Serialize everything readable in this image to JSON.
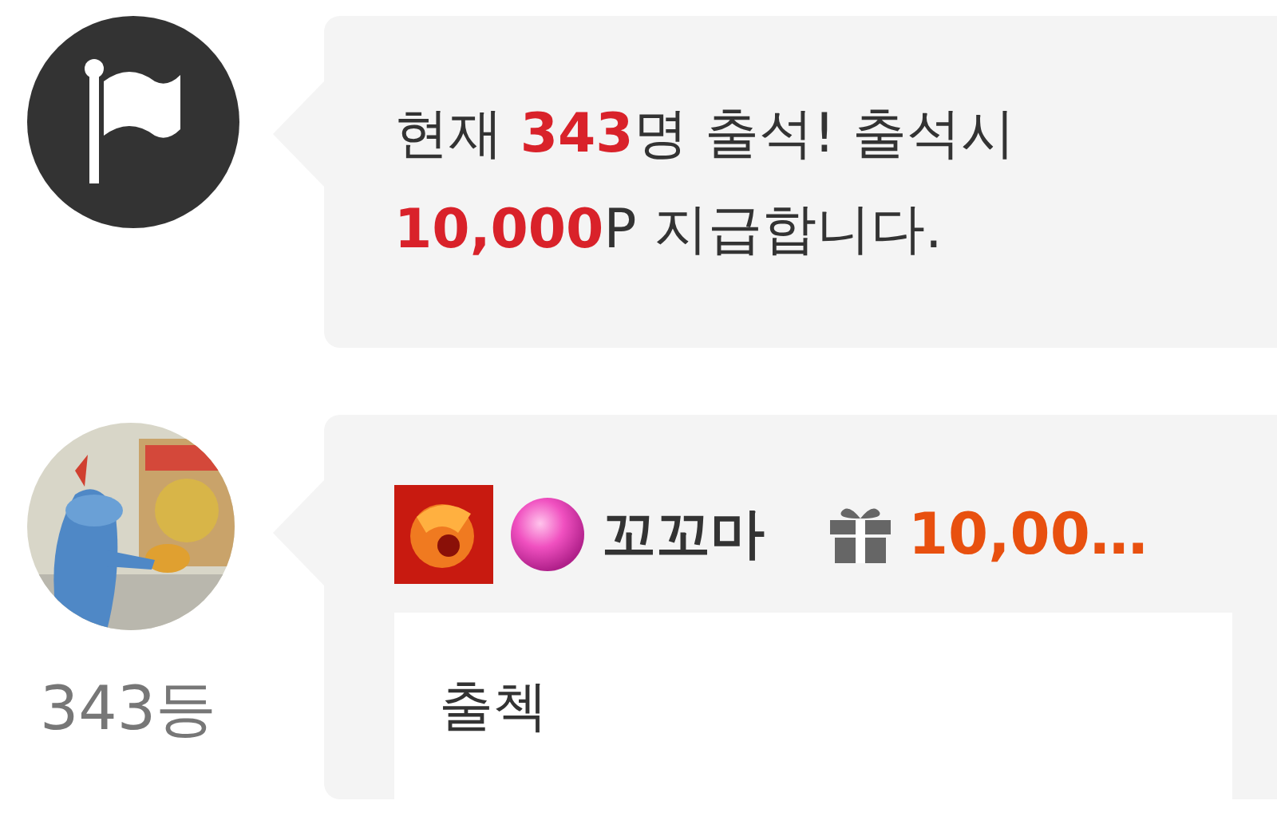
{
  "notice": {
    "message": "현재 **343**명 출석! 출석시\n**10,000**P 지급합니다."
  },
  "comments": [
    {
      "rank": "343등",
      "name": "꼬꼬마",
      "points": "10,00…",
      "text": "출첵"
    }
  ]
}
